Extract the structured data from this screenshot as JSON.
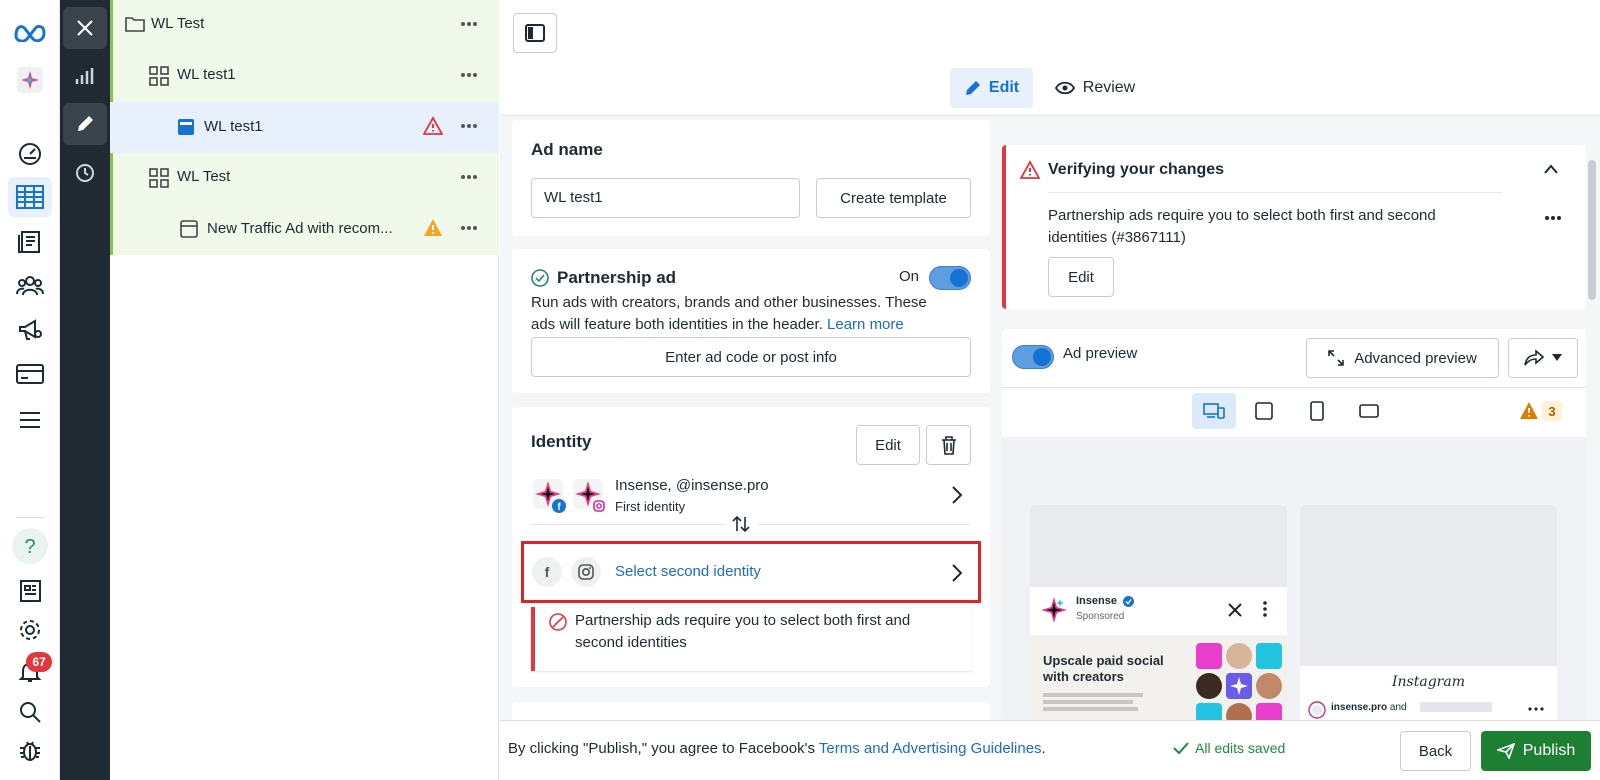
{
  "tree": {
    "rows": [
      {
        "label": "WL Test"
      },
      {
        "label": "WL test1"
      },
      {
        "label": "WL test1"
      },
      {
        "label": "WL Test"
      },
      {
        "label": "New Traffic Ad with recom..."
      }
    ]
  },
  "notifications": {
    "count": "67"
  },
  "topbar": {
    "edit_label": "Edit",
    "review_label": "Review"
  },
  "ad_name": {
    "title": "Ad name",
    "value": "WL test1",
    "create_template_label": "Create template"
  },
  "partnership": {
    "title": "Partnership ad",
    "toggle_label": "On",
    "desc_line1": "Run ads with creators, brands and other businesses. These",
    "desc_line2": "ads will feature both identities in the header.",
    "learn_more": "Learn more",
    "enter_code_label": "Enter ad code or post info"
  },
  "identity": {
    "title": "Identity",
    "edit_label": "Edit",
    "first_name": "Insense, @insense.pro",
    "first_sub": "First identity",
    "select_second_label": "Select second identity",
    "error_line1": "Partnership ads require you to select both first and",
    "error_line2": "second identities"
  },
  "verify": {
    "title": "Verifying your changes",
    "line1": "Partnership ads require you to select both first and second",
    "line2": "identities (#3867111)",
    "edit_label": "Edit"
  },
  "preview": {
    "toggle_label": "Ad preview",
    "advanced_label": "Advanced preview",
    "warning_count": "3",
    "fb_page_name": "Insense",
    "fb_sponsored": "Sponsored",
    "fb_headline_1": "Upscale paid social",
    "fb_headline_2": "with creators",
    "ig_logo": "Instagram",
    "ig_account": "insense.pro",
    "ig_account_suffix": "and"
  },
  "footer": {
    "agree_text": "By clicking \"Publish,\" you agree to Facebook's",
    "terms_link": "Terms and Advertising Guidelines",
    "period": ".",
    "saved_label": "All edits saved",
    "back_label": "Back",
    "publish_label": "Publish"
  },
  "colors": {
    "accent": "#1673d6",
    "publish": "#1e7e34",
    "error": "#e0383e",
    "warning": "#f5a623"
  }
}
